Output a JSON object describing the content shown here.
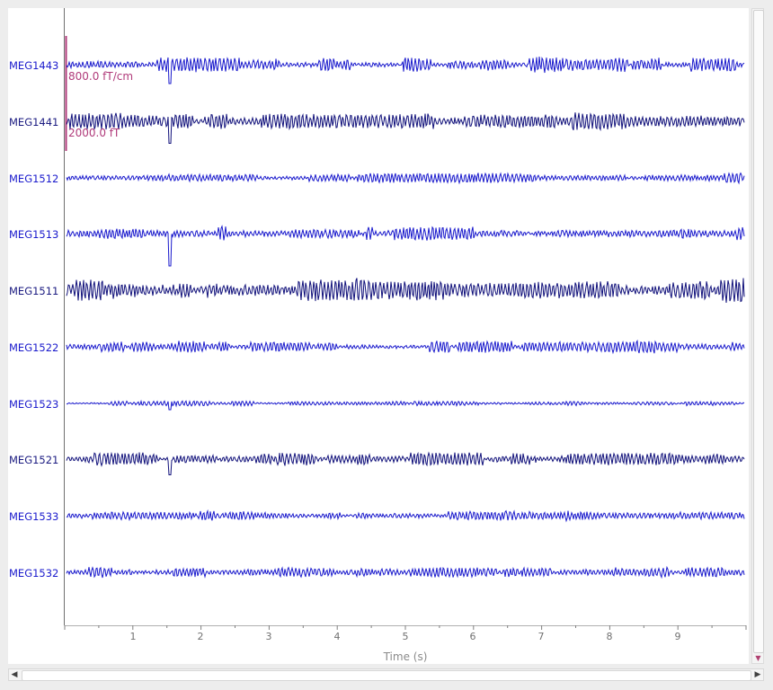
{
  "channels": [
    {
      "name": "MEG1443",
      "amp": 6,
      "seed": 11,
      "color": "#1818cc"
    },
    {
      "name": "MEG1441",
      "amp": 7,
      "seed": 23,
      "color": "#10107a"
    },
    {
      "name": "MEG1512",
      "amp": 4,
      "seed": 37,
      "color": "#1818cc"
    },
    {
      "name": "MEG1513",
      "amp": 6,
      "seed": 41,
      "color": "#1818cc"
    },
    {
      "name": "MEG1511",
      "amp": 10,
      "seed": 53,
      "color": "#10107a"
    },
    {
      "name": "MEG1522",
      "amp": 5,
      "seed": 67,
      "color": "#1818cc"
    },
    {
      "name": "MEG1523",
      "amp": 2,
      "seed": 71,
      "color": "#1818cc"
    },
    {
      "name": "MEG1521",
      "amp": 5,
      "seed": 83,
      "color": "#10107a"
    },
    {
      "name": "MEG1533",
      "amp": 4,
      "seed": 97,
      "color": "#1818cc"
    },
    {
      "name": "MEG1532",
      "amp": 4,
      "seed": 101,
      "color": "#1818cc"
    }
  ],
  "scale_bars": {
    "grad": "800.0 fT/cm",
    "mag": "2000.0 fT",
    "color": "#b03a7a"
  },
  "axis": {
    "xlabel": "Time (s)",
    "ticks": [
      "1",
      "2",
      "3",
      "4",
      "5",
      "6",
      "7",
      "8",
      "9"
    ],
    "xlim": [
      0,
      10
    ]
  },
  "colors": {
    "background": "#ffffff",
    "window": "#ededed",
    "trace_grad": "#1818cc",
    "trace_mag": "#10107a",
    "axis": "#808080"
  }
}
